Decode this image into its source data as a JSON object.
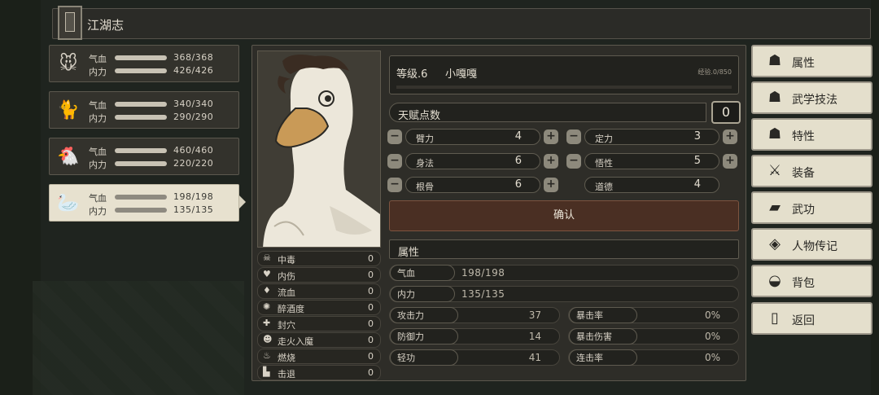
{
  "header": {
    "title": "江湖志"
  },
  "party": [
    {
      "hp_label": "气血",
      "mp_label": "内力",
      "hp": "368/368",
      "mp": "426/426",
      "avatar": "girl-face-icon",
      "selected": false
    },
    {
      "hp_label": "气血",
      "mp_label": "内力",
      "hp": "340/340",
      "mp": "290/290",
      "avatar": "cat-icon",
      "selected": false
    },
    {
      "hp_label": "气血",
      "mp_label": "内力",
      "hp": "460/460",
      "mp": "220/220",
      "avatar": "chicken-icon",
      "selected": false
    },
    {
      "hp_label": "气血",
      "mp_label": "内力",
      "hp": "198/198",
      "mp": "135/135",
      "avatar": "goose-icon",
      "selected": true
    }
  ],
  "character": {
    "level": "等级.6",
    "name": "小嘎嘎",
    "exp": "经验.0/850",
    "talent_label": "天赋点数",
    "talent_points": "0",
    "attributes": [
      {
        "name": "臂力",
        "value": "4"
      },
      {
        "name": "定力",
        "value": "3"
      },
      {
        "name": "身法",
        "value": "6"
      },
      {
        "name": "悟性",
        "value": "5"
      },
      {
        "name": "根骨",
        "value": "6"
      },
      {
        "name": "道德",
        "value": "4"
      }
    ],
    "confirm_label": "确认",
    "section_label": "属性",
    "hp": {
      "label": "气血",
      "value": "198/198"
    },
    "mp": {
      "label": "内力",
      "value": "135/135"
    },
    "stats": [
      {
        "name": "攻击力",
        "value": "37"
      },
      {
        "name": "暴击率",
        "value": "0%"
      },
      {
        "name": "防御力",
        "value": "14"
      },
      {
        "name": "暴击伤害",
        "value": "0%"
      },
      {
        "name": "轻功",
        "value": "41"
      },
      {
        "name": "连击率",
        "value": "0%"
      }
    ]
  },
  "statuses": [
    {
      "name": "中毒",
      "value": "0",
      "icon": "skull-icon"
    },
    {
      "name": "内伤",
      "value": "0",
      "icon": "broken-heart-icon"
    },
    {
      "name": "流血",
      "value": "0",
      "icon": "blood-drop-icon"
    },
    {
      "name": "醉酒度",
      "value": "0",
      "icon": "dizzy-icon"
    },
    {
      "name": "封穴",
      "value": "0",
      "icon": "seal-icon"
    },
    {
      "name": "走火入魔",
      "value": "0",
      "icon": "demon-icon"
    },
    {
      "name": "燃烧",
      "value": "0",
      "icon": "fire-icon"
    },
    {
      "name": "击退",
      "value": "0",
      "icon": "knockback-icon"
    }
  ],
  "menu": [
    {
      "label": "属性",
      "icon": "person-icon"
    },
    {
      "label": "武学技法",
      "icon": "martial-person-icon"
    },
    {
      "label": "特性",
      "icon": "trait-person-icon"
    },
    {
      "label": "装备",
      "icon": "sword-icon"
    },
    {
      "label": "武功",
      "icon": "book-icon"
    },
    {
      "label": "人物传记",
      "icon": "scroll-icon"
    },
    {
      "label": "背包",
      "icon": "bag-icon"
    },
    {
      "label": "返回",
      "icon": "door-icon"
    }
  ]
}
